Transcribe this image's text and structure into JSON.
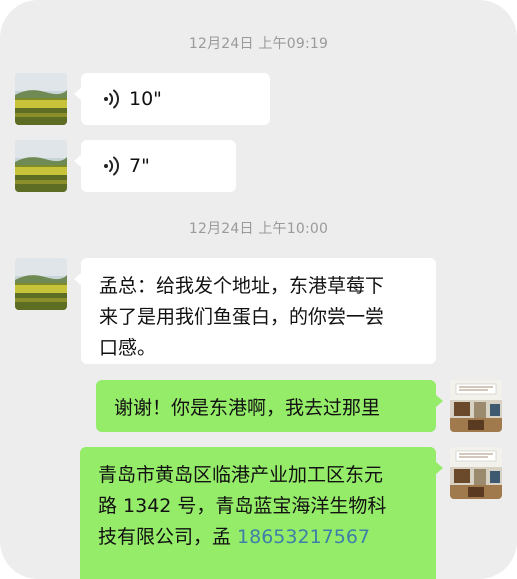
{
  "timestamps": [
    "12月24日 上午09:19",
    "12月24日 上午10:00"
  ],
  "messages": [
    {
      "type": "voice",
      "direction": "in",
      "duration": "10\""
    },
    {
      "type": "voice",
      "direction": "in",
      "duration": "7\""
    },
    {
      "type": "text",
      "direction": "in",
      "lines": [
        "孟总：给我发个地址，东港草莓下",
        "来了是用我们鱼蛋白，的你尝一尝",
        "口感。"
      ]
    },
    {
      "type": "text",
      "direction": "out",
      "text": "谢谢！你是东港啊，我去过那里"
    },
    {
      "type": "text",
      "direction": "out",
      "lines": [
        "青岛市黄岛区临港产业加工区东元",
        "路 1342 号，青岛蓝宝海洋生物科",
        "技有限公司，孟 "
      ],
      "phone": "18653217567"
    }
  ],
  "icons": {
    "voice": "voice-wave-icon",
    "avatar_contact": "meadow-avatar",
    "avatar_self": "office-avatar"
  },
  "colors": {
    "background": "#ededed",
    "incoming": "#ffffff",
    "outgoing": "#95ec69",
    "link": "#3d7fa8",
    "timestamp": "#9a9a9a"
  }
}
